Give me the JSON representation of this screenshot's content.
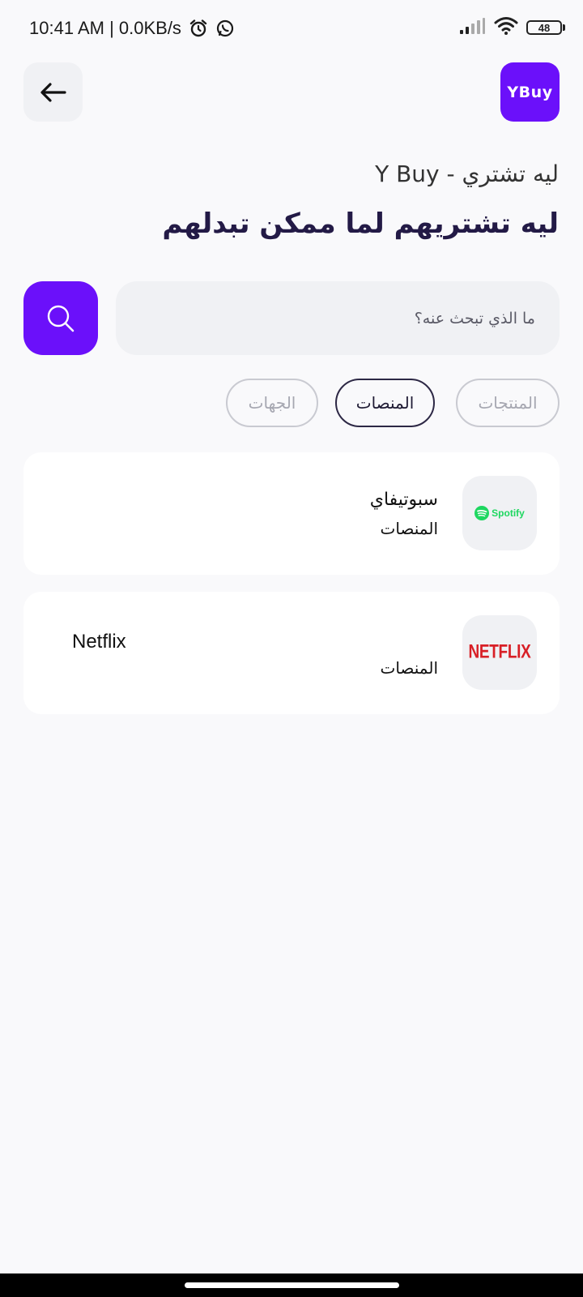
{
  "status_bar": {
    "time_speed": "10:41 AM | 0.0KB/s",
    "battery_level": "48",
    "icons": [
      "alarm-icon",
      "whatsapp-icon",
      "signal-icon",
      "wifi-icon",
      "battery-icon"
    ]
  },
  "header": {
    "back_icon": "arrow-left-icon",
    "logo_text": "YBuy",
    "subtitle": "ليه تشتري - Y Buy",
    "title": "ليه تشتريهم لما ممكن تبدلهم"
  },
  "search": {
    "placeholder": "ما الذي تبحث عنه؟",
    "value": "",
    "icon": "search-icon"
  },
  "tabs": [
    {
      "label": "المنتجات",
      "active": false
    },
    {
      "label": "المنصات",
      "active": true
    },
    {
      "label": "الجهات",
      "active": false
    }
  ],
  "results": [
    {
      "name": "سبوتيفاي",
      "category": "المنصات",
      "logo_text": "Spotify",
      "logo_color": "#1ED760"
    },
    {
      "name": "Netflix",
      "category": "المنصات",
      "logo_text": "NETFLIX",
      "logo_color": "#D81F26"
    }
  ],
  "colors": {
    "accent": "#6B10FA",
    "title": "#231A46",
    "background": "#F9F9FB"
  }
}
